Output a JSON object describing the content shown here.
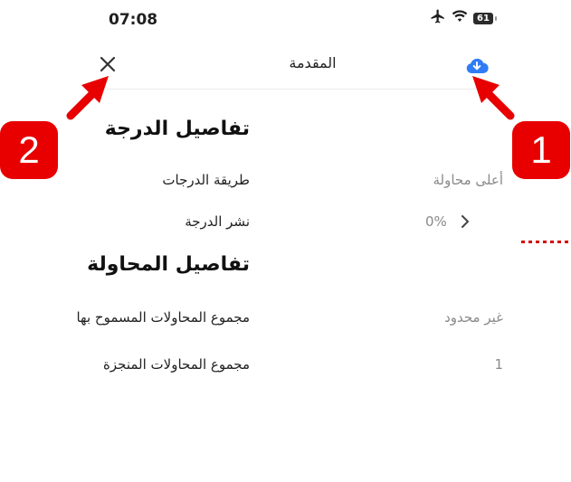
{
  "status_bar": {
    "time": "07:08",
    "battery": "61",
    "icons": [
      "airplane-icon",
      "wifi-icon",
      "battery-icon"
    ]
  },
  "header": {
    "title": "المقدمة",
    "close_icon": "close-icon",
    "action_icon": "cloud-download-icon"
  },
  "grade_details": {
    "title": "تفاصيل الدرجة",
    "rows": [
      {
        "label": "طريقة الدرجات",
        "value": "أعلى محاولة"
      },
      {
        "label": "نشر الدرجة",
        "value": "0%"
      }
    ]
  },
  "attempt_details": {
    "title": "تفاصيل المحاولة",
    "rows": [
      {
        "label": "مجموع المحاولات المسموح بها",
        "value": "غير محدود"
      },
      {
        "label": "مجموع المحاولات المنجزة",
        "value": "1"
      }
    ]
  },
  "annotations": {
    "badge_1": "1",
    "badge_2": "2"
  },
  "colors": {
    "accent_blue": "#2f7cf6",
    "annotation_red": "#e80000",
    "muted_text": "#8a8a8a"
  }
}
